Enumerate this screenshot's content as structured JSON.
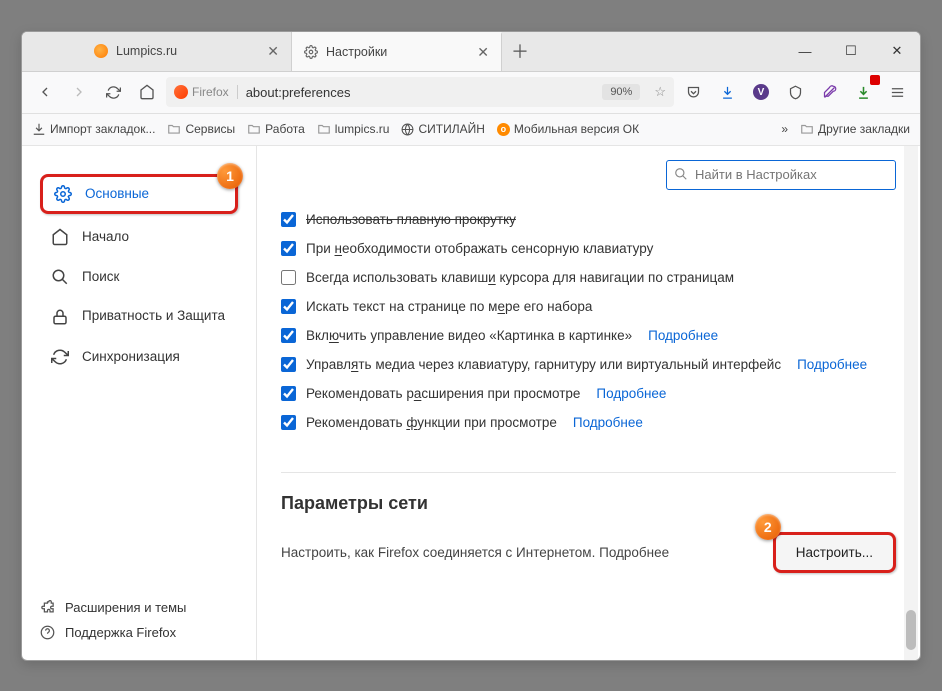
{
  "tabs": [
    {
      "title": "Lumpics.ru",
      "icon": "orange"
    },
    {
      "title": "Настройки",
      "icon": "gear"
    }
  ],
  "window_controls": {
    "min": "—",
    "max": "☐",
    "close": "✕"
  },
  "toolbar": {
    "url_prefix": "Firefox",
    "url": "about:preferences",
    "zoom": "90%"
  },
  "bookmarks": {
    "import": "Импорт закладок...",
    "items": [
      "Сервисы",
      "Работа",
      "lumpics.ru",
      "СИТИЛАЙН",
      "Мобильная версия ОК"
    ],
    "other": "Другие закладки",
    "more": "»"
  },
  "sidebar": {
    "items": [
      {
        "label": "Основные",
        "active": true
      },
      {
        "label": "Начало"
      },
      {
        "label": "Поиск"
      },
      {
        "label": "Приватность и Защита"
      },
      {
        "label": "Синхронизация"
      }
    ],
    "bottom": [
      {
        "label": "Расширения и темы"
      },
      {
        "label": "Поддержка Firefox"
      }
    ]
  },
  "search_placeholder": "Найти в Настройках",
  "options": [
    {
      "checked": true,
      "label_html": "Использовать плавную прокрутку",
      "strike": true
    },
    {
      "checked": true,
      "label_html": "При необходимости отображать сенсорную клавиатуру",
      "u": [
        4
      ]
    },
    {
      "checked": false,
      "label_html": "Всегда использовать клавиши курсора для навигации по страницам",
      "u": [
        26
      ]
    },
    {
      "checked": true,
      "label_html": "Искать текст на странице по мере его набора",
      "u": [
        29
      ]
    },
    {
      "checked": true,
      "label_html": "Включить управление видео «Картинка в картинке»",
      "u": [
        3
      ],
      "link": "Подробнее"
    },
    {
      "checked": true,
      "label_html": "Управлять медиа через клавиатуру, гарнитуру или виртуальный интерфейс",
      "u": [
        6
      ],
      "link": "Подробнее"
    },
    {
      "checked": true,
      "label_html": "Рекомендовать расширения при просмотре",
      "u": [
        15
      ],
      "link": "Подробнее"
    },
    {
      "checked": true,
      "label_html": "Рекомендовать функции при просмотре",
      "u": [
        14
      ],
      "link": "Подробнее"
    }
  ],
  "network": {
    "title": "Параметры сети",
    "desc": "Настроить, как Firefox соединяется с Интернетом.",
    "link": "Подробнее",
    "btn": "Настроить..."
  },
  "annotations": {
    "b1": "1",
    "b2": "2"
  }
}
